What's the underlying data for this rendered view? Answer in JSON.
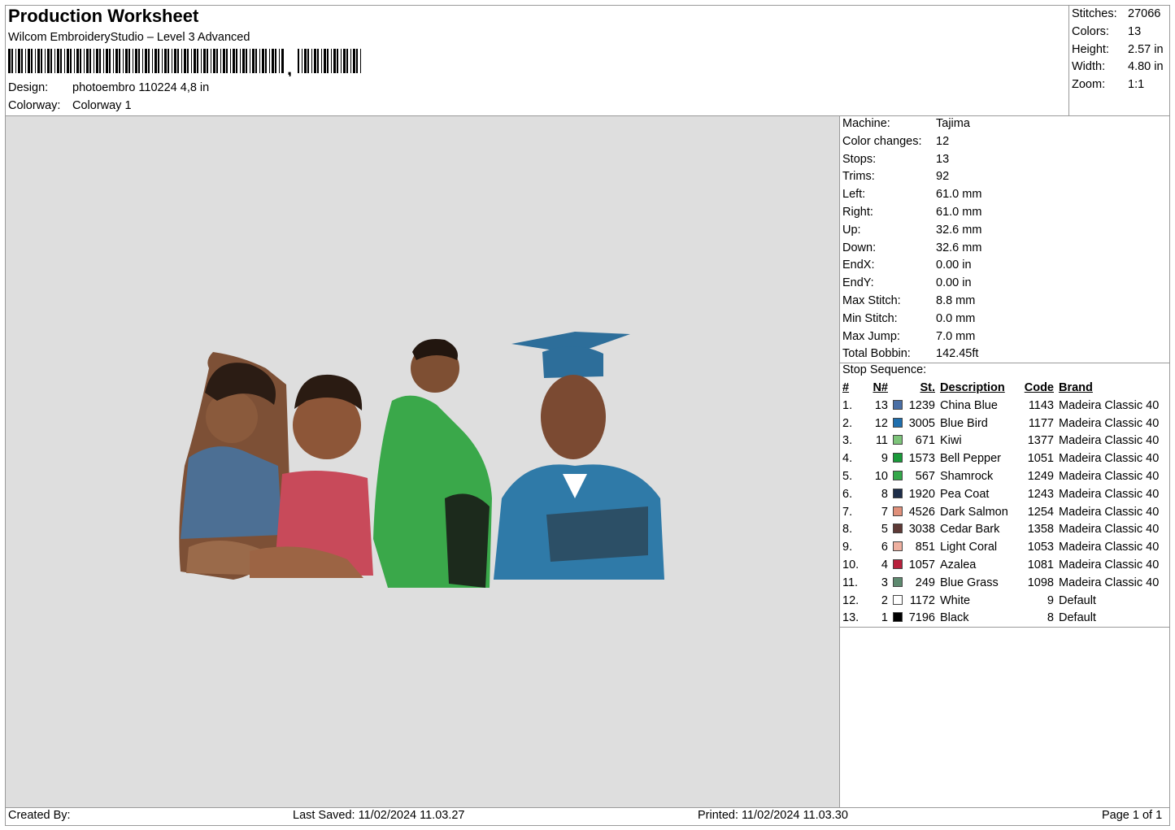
{
  "header": {
    "title": "Production Worksheet",
    "subtitle": "Wilcom EmbroideryStudio – Level 3 Advanced",
    "design_label": "Design:",
    "design_value": "photoembro 110224 4,8 in",
    "colorway_label": "Colorway:",
    "colorway_value": "Colorway 1"
  },
  "stats": [
    {
      "label": "Stitches:",
      "value": "27066"
    },
    {
      "label": "Colors:",
      "value": "13"
    },
    {
      "label": "Height:",
      "value": "2.57 in"
    },
    {
      "label": "Width:",
      "value": "4.80 in"
    },
    {
      "label": "Zoom:",
      "value": "1:1"
    }
  ],
  "machine_info": [
    {
      "label": "Machine:",
      "value": "Tajima"
    },
    {
      "label": "Color changes:",
      "value": "12"
    },
    {
      "label": "Stops:",
      "value": "13"
    },
    {
      "label": "Trims:",
      "value": "92"
    },
    {
      "label": "Left:",
      "value": "61.0 mm"
    },
    {
      "label": "Right:",
      "value": "61.0 mm"
    },
    {
      "label": "Up:",
      "value": "32.6 mm"
    },
    {
      "label": "Down:",
      "value": "32.6 mm"
    },
    {
      "label": "EndX:",
      "value": "0.00 in"
    },
    {
      "label": "EndY:",
      "value": "0.00 in"
    },
    {
      "label": "Max Stitch:",
      "value": "8.8 mm"
    },
    {
      "label": "Min Stitch:",
      "value": "0.0 mm"
    },
    {
      "label": "Max Jump:",
      "value": "7.0 mm"
    },
    {
      "label": "Total Bobbin:",
      "value": "142.45ft"
    }
  ],
  "stop_sequence": {
    "title": "Stop Sequence:",
    "headers": {
      "num": "#",
      "n": "N#",
      "st": "St.",
      "description": "Description",
      "code": "Code",
      "brand": "Brand"
    },
    "rows": [
      {
        "num": "1.",
        "n": "13",
        "color": "#4a6fa5",
        "st": "1239",
        "description": "China Blue",
        "code": "1143",
        "brand": "Madeira Classic 40"
      },
      {
        "num": "2.",
        "n": "12",
        "color": "#1f6fae",
        "st": "3005",
        "description": "Blue Bird",
        "code": "1177",
        "brand": "Madeira Classic 40"
      },
      {
        "num": "3.",
        "n": "11",
        "color": "#7dc47a",
        "st": "671",
        "description": "Kiwi",
        "code": "1377",
        "brand": "Madeira Classic 40"
      },
      {
        "num": "4.",
        "n": "9",
        "color": "#1a9a3a",
        "st": "1573",
        "description": "Bell Pepper",
        "code": "1051",
        "brand": "Madeira Classic 40"
      },
      {
        "num": "5.",
        "n": "10",
        "color": "#34a84a",
        "st": "567",
        "description": "Shamrock",
        "code": "1249",
        "brand": "Madeira Classic 40"
      },
      {
        "num": "6.",
        "n": "8",
        "color": "#1e2e4a",
        "st": "1920",
        "description": "Pea Coat",
        "code": "1243",
        "brand": "Madeira Classic 40"
      },
      {
        "num": "7.",
        "n": "7",
        "color": "#e0907a",
        "st": "4526",
        "description": "Dark Salmon",
        "code": "1254",
        "brand": "Madeira Classic 40"
      },
      {
        "num": "8.",
        "n": "5",
        "color": "#5e3a36",
        "st": "3038",
        "description": "Cedar Bark",
        "code": "1358",
        "brand": "Madeira Classic 40"
      },
      {
        "num": "9.",
        "n": "6",
        "color": "#efb0a0",
        "st": "851",
        "description": "Light Coral",
        "code": "1053",
        "brand": "Madeira Classic 40"
      },
      {
        "num": "10.",
        "n": "4",
        "color": "#b8203c",
        "st": "1057",
        "description": "Azalea",
        "code": "1081",
        "brand": "Madeira Classic 40"
      },
      {
        "num": "11.",
        "n": "3",
        "color": "#5e8a70",
        "st": "249",
        "description": "Blue Grass",
        "code": "1098",
        "brand": "Madeira Classic 40"
      },
      {
        "num": "12.",
        "n": "2",
        "color": "#ffffff",
        "st": "1172",
        "description": "White",
        "code": "9",
        "brand": "Default"
      },
      {
        "num": "13.",
        "n": "1",
        "color": "#000000",
        "st": "7196",
        "description": "Black",
        "code": "8",
        "brand": "Default"
      }
    ]
  },
  "footer": {
    "created_by": "Created By:",
    "last_saved": "Last Saved: 11/02/2024 11.03.27",
    "printed": "Printed: 11/02/2024 11.03.30",
    "page": "Page 1 of 1"
  }
}
